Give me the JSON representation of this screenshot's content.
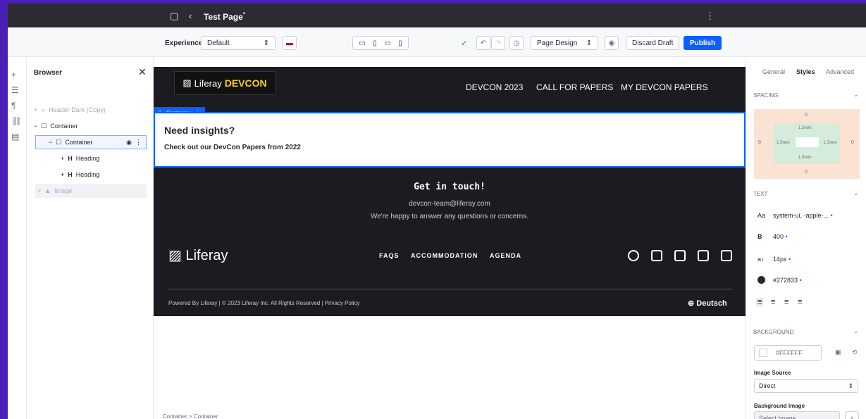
{
  "topbar": {
    "title": "Test Page",
    "title_mark": "*"
  },
  "toolbar": {
    "experience_label": "Experience",
    "experience_value": "Default",
    "page_design": "Page Design",
    "discard": "Discard Draft",
    "publish": "Publish"
  },
  "browser": {
    "title": "Browser",
    "items": [
      {
        "label": "Header Dark (Copy)"
      },
      {
        "label": "Container"
      },
      {
        "label": "Container"
      },
      {
        "label": "Heading"
      },
      {
        "label": "Heading"
      },
      {
        "label": "Image"
      }
    ]
  },
  "canvas": {
    "logo_prefix": "Liferay",
    "logo_brand": "DEVCON",
    "nav": [
      "DEVCON 2023",
      "CALL FOR PAPERS",
      "MY DEVCON PAPERS"
    ],
    "container_label": "Container",
    "heading": "Need insights?",
    "subheading": "Check out our DevCon Papers from 2022",
    "footer": {
      "title": "Get in touch!",
      "email": "devcon-team@liferay.com",
      "tagline": "We're happy to answer any questions or concerns.",
      "logo": "Liferay",
      "links": [
        "FAQS",
        "ACCOMMODATION",
        "AGENDA"
      ],
      "copyright": "Powered By Liferay | © 2023 Liferay Inc. All Rights Reserved | Privacy Policy",
      "language": "Deutsch"
    },
    "breadcrumb": "Container > Container"
  },
  "panel": {
    "tabs": [
      "General",
      "Styles",
      "Advanced"
    ],
    "spacing_label": "SPACING",
    "margin": "0",
    "padding": "1.5rem",
    "text_label": "TEXT",
    "font": "system-ui, -apple-...",
    "weight": "400",
    "size": "14px",
    "color": "#272833",
    "background_label": "BACKGROUND",
    "bg_color": "#FFFFFF",
    "image_source_label": "Image Source",
    "image_source": "Direct",
    "bg_image_label": "Background Image",
    "bg_image_placeholder": "Select Image"
  }
}
